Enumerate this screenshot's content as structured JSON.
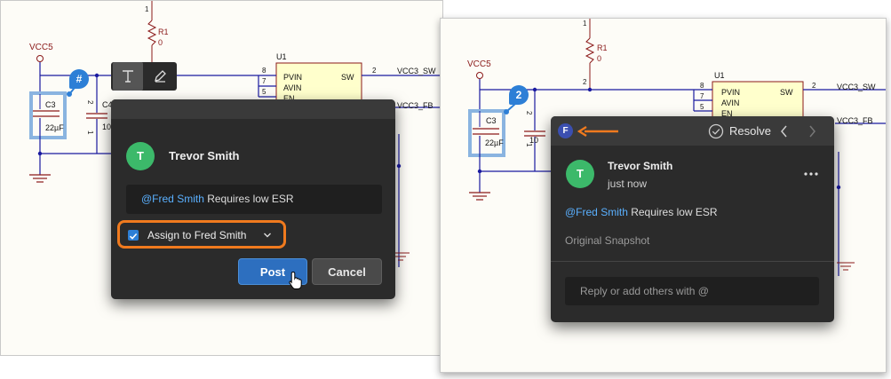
{
  "schematic": {
    "vcc5": "VCC5",
    "r1_ref": "R1",
    "r1_val": "0",
    "pin_1": "1",
    "pin_2": "2",
    "pin_5": "5",
    "pin_7": "7",
    "pin_8": "8",
    "c3_ref": "C3",
    "c3_val": "22µF",
    "c4_ref": "C4",
    "c4_val": "10",
    "u1_ref": "U1",
    "u1_pvin": "PVIN",
    "u1_avin": "AVIN",
    "u1_en": "EN",
    "u1_sw": "SW",
    "net_sw": "VCC3_SW",
    "net_fb": "VCC3_FB"
  },
  "left": {
    "pin_badge": "#",
    "toolbar": {
      "text_icon": "text-icon",
      "pen_icon": "pen-icon"
    },
    "dialog": {
      "avatar_initial": "T",
      "author": "Trevor Smith",
      "comment_mention": "@Fred Smith",
      "comment_text": " Requires low ESR",
      "assign_label": "Assign to Fred Smith",
      "assign_checked": true,
      "post_label": "Post",
      "cancel_label": "Cancel"
    }
  },
  "right": {
    "pin_badge": "2",
    "panel": {
      "assignee_initial": "F",
      "resolve_label": "Resolve",
      "avatar_initial": "T",
      "author": "Trevor Smith",
      "time": "just now",
      "comment_mention": "@Fred Smith",
      "comment_text": " Requires low ESR",
      "snapshot_label": "Original Snapshot",
      "reply_placeholder": "Reply or add others with @"
    }
  },
  "colors": {
    "accent": "#2d7fd6",
    "highlight": "#f07a1e",
    "dialog_bg": "#2b2b2b",
    "input_bg": "#1f1f1f",
    "avatar": "#3cb96a",
    "mention": "#5ab0ff",
    "wire": "#1a1aa0",
    "component": "#8b1a1a"
  }
}
